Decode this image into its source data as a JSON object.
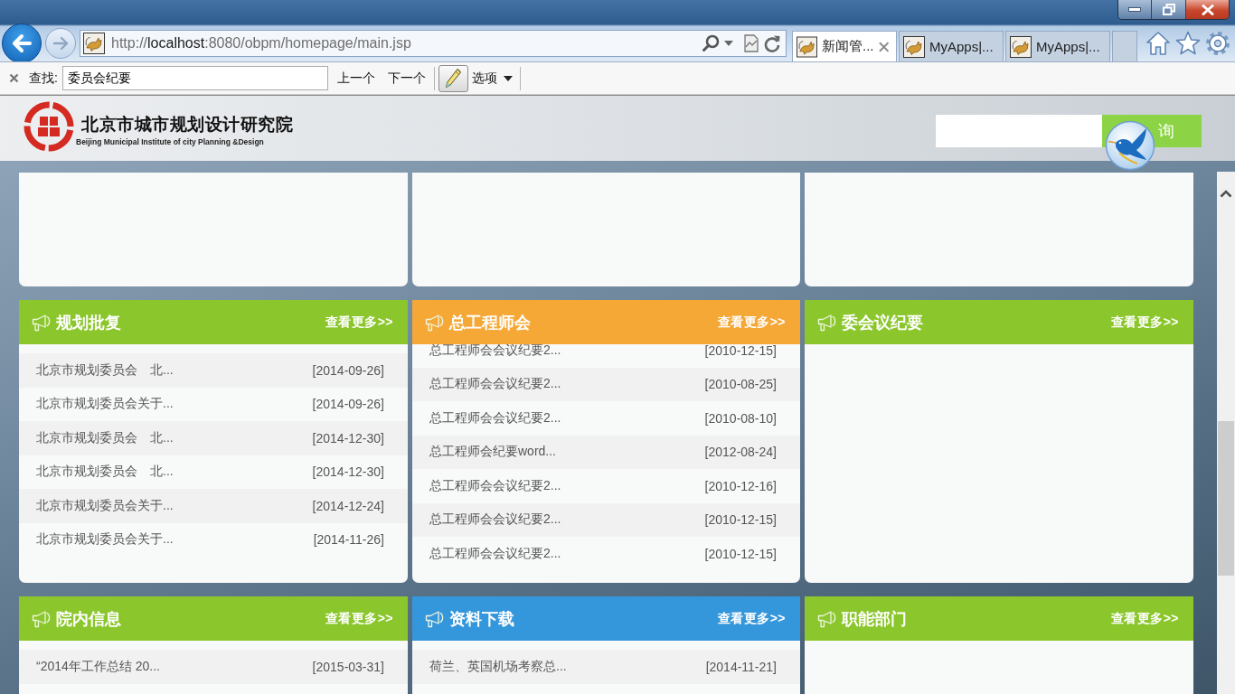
{
  "browser": {
    "url": "http://**localhost**:8080/obpm/homepage/main.jsp",
    "tabs": [
      {
        "title": "新闻管...",
        "selected": true
      },
      {
        "title": "MyApps|...",
        "selected": false
      },
      {
        "title": "MyApps|...",
        "selected": false
      }
    ]
  },
  "find_bar": {
    "label": "查找:",
    "query": "委员会纪要",
    "previous": "上一个",
    "next": "下一个",
    "highlight_all": true,
    "options": "选项"
  },
  "site_header": {
    "name": "北京市城市规划设计研究院",
    "name_en": "Beijing Municipal Institute of city Planning &Design",
    "search_button": "询"
  },
  "panels": [
    {
      "title": "规划批复",
      "color": "#8bc72c",
      "more": "查看更多>>",
      "scrolled": false,
      "items": [
        {
          "title": "北京市规划委员会　北...",
          "date": "[2014-09-26]"
        },
        {
          "title": "北京市规划委员会关于...",
          "date": "[2014-09-26]"
        },
        {
          "title": "北京市规划委员会　北...",
          "date": "[2014-12-30]"
        },
        {
          "title": "北京市规划委员会　北...",
          "date": "[2014-12-30]"
        },
        {
          "title": "北京市规划委员会关于...",
          "date": "[2014-12-24]"
        },
        {
          "title": "北京市规划委员会关于...",
          "date": "[2014-11-26]"
        }
      ]
    },
    {
      "title": "总工程师会",
      "color": "#f6a836",
      "more": "查看更多>>",
      "scrolled": true,
      "items": [
        {
          "title": "总工程师会会议纪要2...",
          "date": "[2010-12-15]"
        },
        {
          "title": "总工程师会会议纪要2...",
          "date": "[2010-08-25]"
        },
        {
          "title": "总工程师会会议纪要2...",
          "date": "[2010-08-10]"
        },
        {
          "title": "总工程师会纪要word...",
          "date": "[2012-08-24]"
        },
        {
          "title": "总工程师会会议纪要2...",
          "date": "[2010-12-16]"
        },
        {
          "title": "总工程师会会议纪要2...",
          "date": "[2010-12-15]"
        },
        {
          "title": "总工程师会会议纪要2...",
          "date": "[2010-12-15]"
        }
      ]
    },
    {
      "title": "委会议纪要",
      "color": "#8bc72c",
      "more": "查看更多>>"
    },
    {
      "title": "院内信息",
      "color": "#8bc72c",
      "more": "查看更多>>",
      "scrolled": false,
      "items": [
        {
          "title": "“2014年工作总结 20...",
          "date": "[2015-03-31]"
        }
      ]
    },
    {
      "title": "资料下载",
      "color": "#3597db",
      "more": "查看更多>>",
      "scrolled": false,
      "items": [
        {
          "title": "荷兰、英国机场考察总...",
          "date": "[2014-11-21]"
        }
      ]
    },
    {
      "title": "职能部门",
      "color": "#8bc72c",
      "more": "查看更多>>"
    }
  ]
}
